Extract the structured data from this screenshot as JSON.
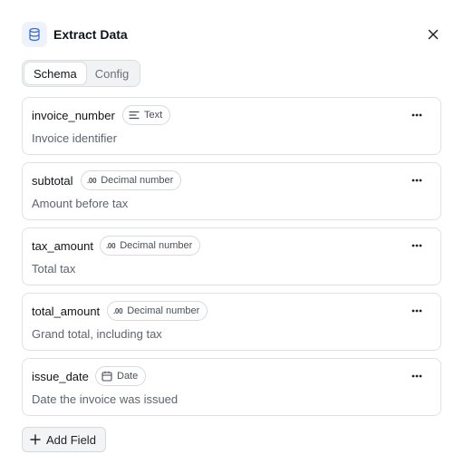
{
  "header": {
    "title": "Extract Data",
    "icon": "database-icon",
    "accent": "#3b6fd8"
  },
  "tabs": [
    {
      "label": "Schema",
      "active": true
    },
    {
      "label": "Config",
      "active": false
    }
  ],
  "fields": [
    {
      "name": "invoice_number",
      "type": "Text",
      "type_icon": "text-lines-icon",
      "description": "Invoice identifier"
    },
    {
      "name": "subtotal",
      "type": "Decimal number",
      "type_icon": "decimal-icon",
      "description": "Amount before tax"
    },
    {
      "name": "tax_amount",
      "type": "Decimal number",
      "type_icon": "decimal-icon",
      "description": "Total tax"
    },
    {
      "name": "total_amount",
      "type": "Decimal number",
      "type_icon": "decimal-icon",
      "description": "Grand total, including tax"
    },
    {
      "name": "issue_date",
      "type": "Date",
      "type_icon": "calendar-icon",
      "description": "Date the invoice was issued"
    }
  ],
  "decimal_glyph": ".00",
  "add_field_label": "Add Field"
}
